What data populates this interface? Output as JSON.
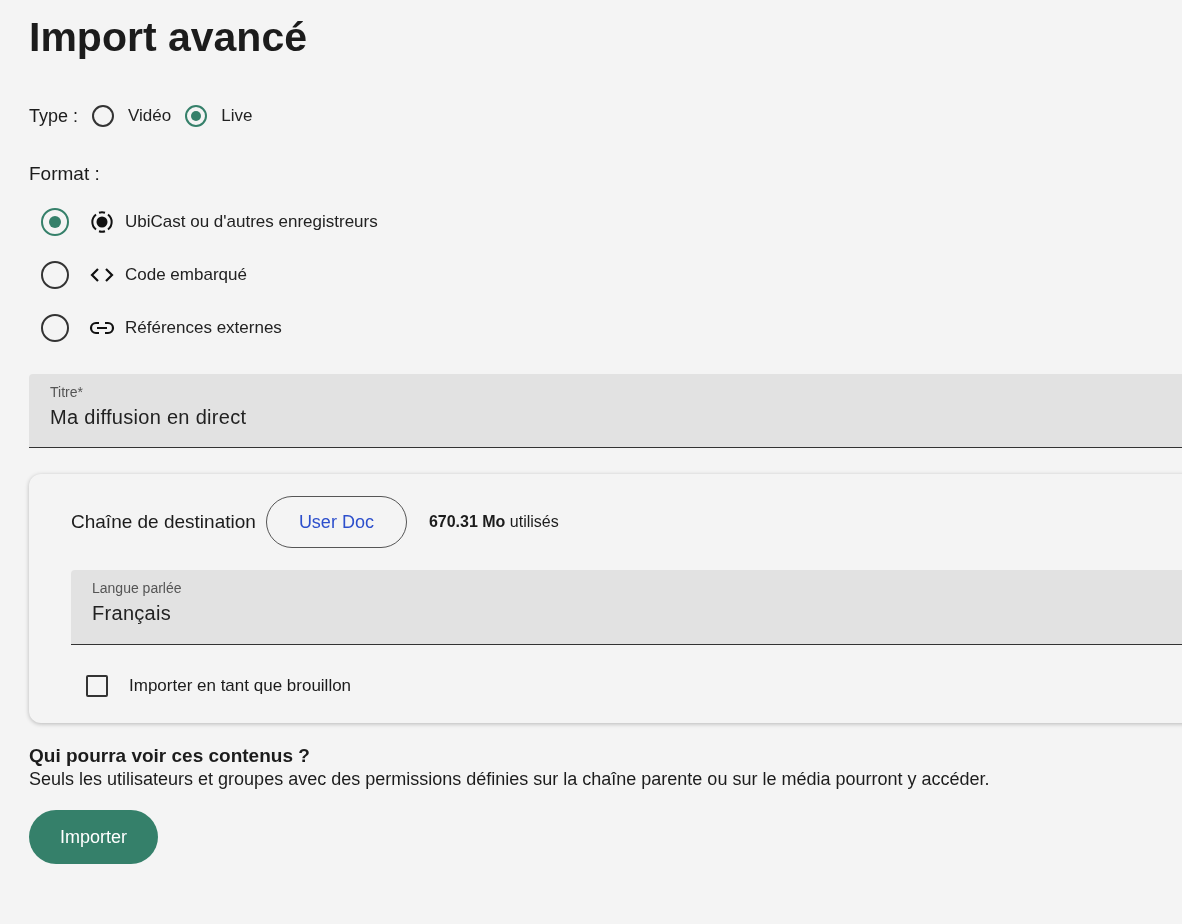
{
  "title": "Import avancé",
  "type": {
    "label": "Type :",
    "options": [
      {
        "label": "Vidéo",
        "selected": false
      },
      {
        "label": "Live",
        "selected": true
      }
    ]
  },
  "format": {
    "label": "Format :",
    "options": [
      {
        "label": "UbiCast ou d'autres enregistreurs",
        "kind": "recorder",
        "selected": true
      },
      {
        "label": "Code embarqué",
        "kind": "code",
        "selected": false
      },
      {
        "label": "Références externes",
        "kind": "link",
        "selected": false
      }
    ]
  },
  "title_field": {
    "label": "Titre*",
    "value": "Ma diffusion en direct"
  },
  "destination": {
    "label": "Chaîne de destination",
    "channel_button": "User Doc",
    "usage": "**670.31 Mo** utilisés",
    "language_field": {
      "label": "Langue parlée",
      "value": "Français"
    },
    "draft_checkbox": {
      "label": "Importer en tant que brouillon",
      "checked": false
    }
  },
  "visibility": {
    "heading": "Qui pourra voir ces contenus ?",
    "text": "Seuls les utilisateurs et groupes avec des permissions définies sur la chaîne parente ou sur le média pourront y accéder."
  },
  "submit_button": "Importer"
}
